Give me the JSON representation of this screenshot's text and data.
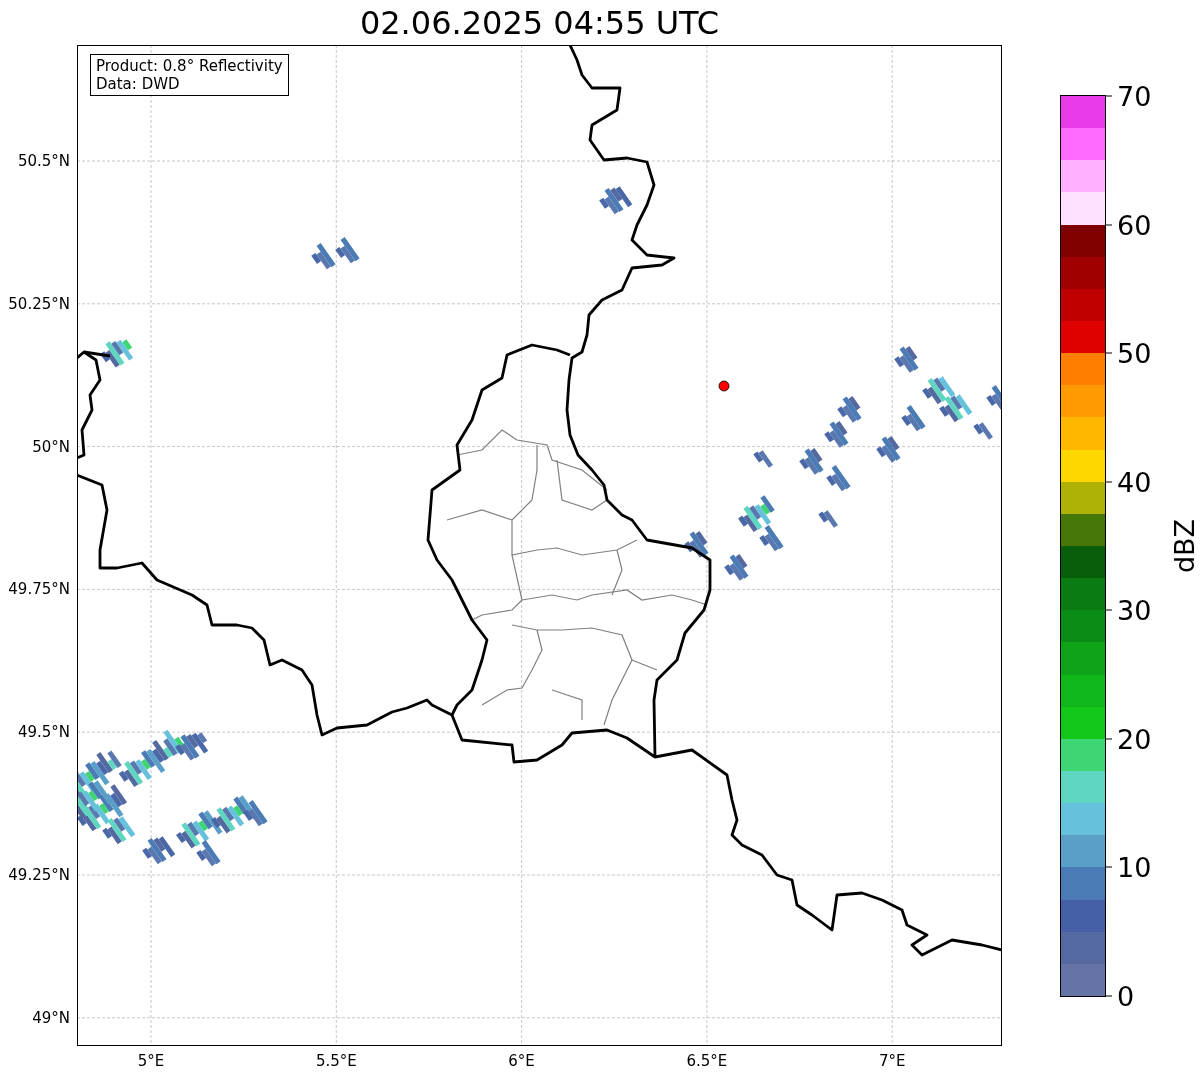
{
  "title": "02.06.2025 04:55 UTC",
  "info_box": {
    "lines": [
      "Product: 0.8° Reflectivity",
      "Data: DWD"
    ]
  },
  "map": {
    "y_ticks": [
      "50.5°N",
      "50.25°N",
      "50°N",
      "49.75°N",
      "49.5°N",
      "49.25°N",
      "49°N"
    ],
    "x_ticks": [
      "5°E",
      "5.5°E",
      "6°E",
      "6.5°E",
      "7°E"
    ]
  },
  "colorbar": {
    "label": "dBZ",
    "ticks": [
      "70",
      "60",
      "50",
      "40",
      "30",
      "20",
      "10",
      "0"
    ],
    "segments": [
      {
        "color": "#e83ae8"
      },
      {
        "color": "#ff6aff"
      },
      {
        "color": "#ffb0ff"
      },
      {
        "color": "#ffe0ff"
      },
      {
        "color": "#800000"
      },
      {
        "color": "#a00000"
      },
      {
        "color": "#c00000"
      },
      {
        "color": "#e00000"
      },
      {
        "color": "#ff7e00"
      },
      {
        "color": "#ff9a00"
      },
      {
        "color": "#ffb700"
      },
      {
        "color": "#ffd700"
      },
      {
        "color": "#afb204"
      },
      {
        "color": "#477708"
      },
      {
        "color": "#085e0b"
      },
      {
        "color": "#0a7a12"
      },
      {
        "color": "#0b8c17"
      },
      {
        "color": "#0fa31a"
      },
      {
        "color": "#10b81c"
      },
      {
        "color": "#13c81a"
      },
      {
        "color": "#3dd672"
      },
      {
        "color": "#5fd6c0"
      },
      {
        "color": "#66c2dc"
      },
      {
        "color": "#5a9fc8"
      },
      {
        "color": "#4a7bb4"
      },
      {
        "color": "#4560a6"
      },
      {
        "color": "#5469a0"
      },
      {
        "color": "#6573a6"
      }
    ]
  }
}
